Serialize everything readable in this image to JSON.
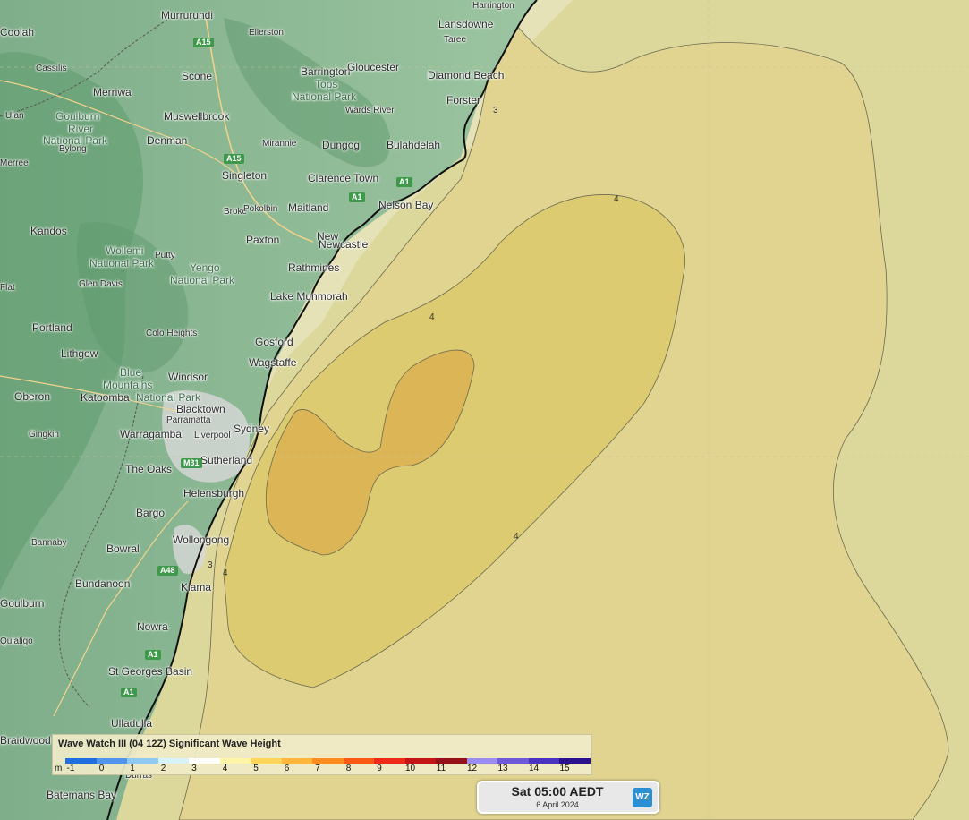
{
  "legend": {
    "title": "Wave Watch III (04 12Z) Significant Wave Height",
    "unit": "m",
    "ticks": [
      "-1",
      "0",
      "1",
      "2",
      "3",
      "4",
      "5",
      "6",
      "7",
      "8",
      "9",
      "10",
      "11",
      "12",
      "13",
      "14",
      "15"
    ],
    "colors": [
      "#1f6fe0",
      "#4f95ee",
      "#8ec9f2",
      "#d8f3f8",
      "#ffffff",
      "#fff5a6",
      "#ffd65a",
      "#ffb63a",
      "#ff8c1f",
      "#ff5a14",
      "#f02a18",
      "#c41416",
      "#96101a",
      "#9a8cf0",
      "#6e5ad8",
      "#4a32c2",
      "#2a128e"
    ]
  },
  "timebox": {
    "time": "Sat 05:00 AEDT",
    "date": "6 April 2024",
    "logo": "WZ"
  },
  "contour_labels": [
    "3",
    "4",
    "4",
    "4",
    "4",
    "3"
  ],
  "places": [
    {
      "name": "Murrurundi"
    },
    {
      "name": "Lansdowne"
    },
    {
      "name": "Harrington"
    },
    {
      "name": "Taree"
    },
    {
      "name": "Ellerston"
    },
    {
      "name": "Cassilis"
    },
    {
      "name": "Barrington"
    },
    {
      "name": "Gloucester"
    },
    {
      "name": "Tops"
    },
    {
      "name": "National Park"
    },
    {
      "name": "Diamond Beach"
    },
    {
      "name": "Merriwa"
    },
    {
      "name": "Scone"
    },
    {
      "name": "Forster"
    },
    {
      "name": "Wards River"
    },
    {
      "name": "Ulan"
    },
    {
      "name": "Goulburn"
    },
    {
      "name": "Muswellbrook"
    },
    {
      "name": "River"
    },
    {
      "name": "National Park"
    },
    {
      "name": "Denman"
    },
    {
      "name": "Mirannie"
    },
    {
      "name": "Dungog"
    },
    {
      "name": "Bulahdelah"
    },
    {
      "name": "Bylong"
    },
    {
      "name": "Singleton"
    },
    {
      "name": "Clarence Town"
    },
    {
      "name": "Nelson Bay"
    },
    {
      "name": "Broke"
    },
    {
      "name": "Pokolbin"
    },
    {
      "name": "Maitland"
    },
    {
      "name": "Kandos"
    },
    {
      "name": "Paxton"
    },
    {
      "name": "New"
    },
    {
      "name": "Newcastle"
    },
    {
      "name": "Wollemi"
    },
    {
      "name": "Putty"
    },
    {
      "name": "National Park"
    },
    {
      "name": "Yengo"
    },
    {
      "name": "Rathmines"
    },
    {
      "name": "National Park"
    },
    {
      "name": "Glen Davis"
    },
    {
      "name": "Lake Munmorah"
    },
    {
      "name": "Portland"
    },
    {
      "name": "Colo Heights"
    },
    {
      "name": "Gosford"
    },
    {
      "name": "Lithgow"
    },
    {
      "name": "Wagstaffe"
    },
    {
      "name": "Blue"
    },
    {
      "name": "Windsor"
    },
    {
      "name": "Mountains"
    },
    {
      "name": "Oberon"
    },
    {
      "name": "Katoomba"
    },
    {
      "name": "National Park"
    },
    {
      "name": "Blacktown"
    },
    {
      "name": "Parramatta"
    },
    {
      "name": "Sydney"
    },
    {
      "name": "Gingkin"
    },
    {
      "name": "Warragamba"
    },
    {
      "name": "Liverpool"
    },
    {
      "name": "Sutherland"
    },
    {
      "name": "The Oaks"
    },
    {
      "name": "Helensburgh"
    },
    {
      "name": "Bargo"
    },
    {
      "name": "Bannaby"
    },
    {
      "name": "Bowral"
    },
    {
      "name": "Wollongong"
    },
    {
      "name": "Bundanoon"
    },
    {
      "name": "Kiama"
    },
    {
      "name": "Goulburn"
    },
    {
      "name": "Nowra"
    },
    {
      "name": "St Georges Basin"
    },
    {
      "name": "Ulladulla"
    },
    {
      "name": "Braidwood"
    },
    {
      "name": "Batemans Bay"
    },
    {
      "name": "Durras"
    },
    {
      "name": "Merree"
    },
    {
      "name": "Flat"
    },
    {
      "name": "Quialigo"
    },
    {
      "name": "Coolah"
    }
  ],
  "shields": [
    "A15",
    "A15",
    "A1",
    "A1",
    "M31",
    "A48",
    "A1",
    "A1"
  ]
}
